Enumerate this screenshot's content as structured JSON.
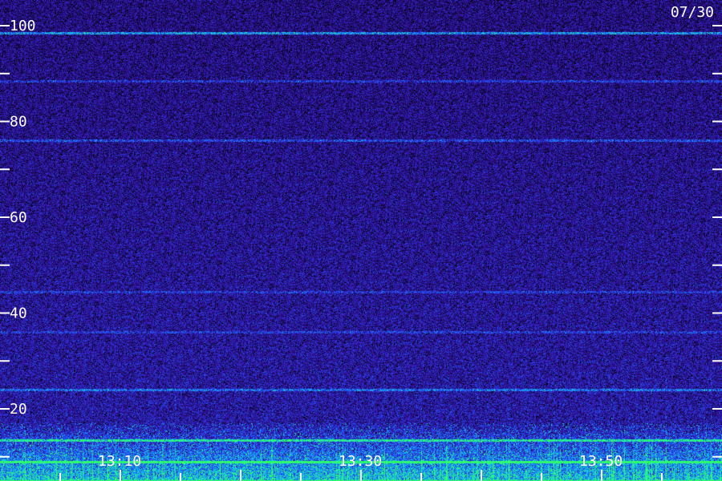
{
  "chart_data": {
    "type": "heatmap",
    "title": "",
    "date_label": "07/30",
    "y_tick_labels": [
      "100",
      "80",
      "60",
      "40",
      "20"
    ],
    "y_ticks": [
      100,
      90,
      80,
      70,
      60,
      50,
      40,
      30,
      20,
      10
    ],
    "y_range": [
      0,
      100
    ],
    "x_tick_labels": [
      "13:10",
      "13:30",
      "13:50"
    ],
    "x_minor_ticks_per_label": 4,
    "x_range_minutes": [
      "13:00",
      "14:00"
    ],
    "colormap": [
      "#000000",
      "#1a0a5a",
      "#3a16b8",
      "#1a5cff",
      "#18c8e8",
      "#2fff6a"
    ],
    "background": "#17084f",
    "bands": [
      {
        "y": 98.5,
        "intensity": 0.55
      },
      {
        "y": 88.5,
        "intensity": 0.25
      },
      {
        "y": 76.0,
        "intensity": 0.3
      },
      {
        "y": 44.5,
        "intensity": 0.2
      },
      {
        "y": 36.0,
        "intensity": 0.2
      },
      {
        "y": 24.0,
        "intensity": 0.35
      },
      {
        "y": 13.5,
        "intensity": 0.6
      },
      {
        "y": 9.0,
        "intensity": 0.75
      },
      {
        "y": 5.0,
        "intensity": 0.8
      }
    ],
    "low_freq_activity_below": 17
  }
}
